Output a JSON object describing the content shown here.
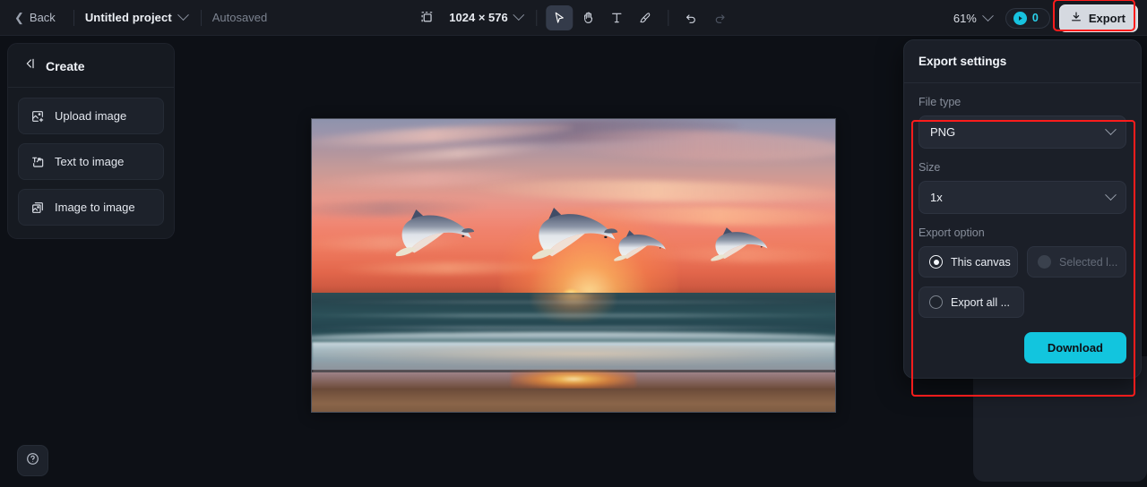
{
  "topbar": {
    "back_label": "Back",
    "project_name": "Untitled project",
    "autosave_label": "Autosaved",
    "canvas_size": "1024 × 576",
    "tools": [
      {
        "name": "select-tool",
        "glyph": "cursor",
        "active": true
      },
      {
        "name": "hand-tool",
        "glyph": "hand",
        "active": false
      },
      {
        "name": "text-tool",
        "glyph": "text",
        "active": false
      },
      {
        "name": "brush-tool",
        "glyph": "brush",
        "active": false
      },
      {
        "name": "undo-button",
        "glyph": "undo",
        "active": false
      },
      {
        "name": "redo-button",
        "glyph": "redo",
        "active": false
      }
    ],
    "zoom_level": "61%",
    "credits_count": "0",
    "export_label": "Export"
  },
  "create_panel": {
    "title": "Create",
    "collapse_icon": "collapse-left-icon",
    "items": [
      {
        "label": "Upload image",
        "icon": "upload-image-icon"
      },
      {
        "label": "Text to image",
        "icon": "text-to-image-icon"
      },
      {
        "label": "Image to image",
        "icon": "image-to-image-icon"
      }
    ]
  },
  "help": {
    "icon": "help-circle-icon"
  },
  "export_settings": {
    "title": "Export settings",
    "file_type": {
      "label": "File type",
      "value": "PNG"
    },
    "size": {
      "label": "Size",
      "value": "1x"
    },
    "export_option": {
      "label": "Export option",
      "options": [
        {
          "label": "This canvas",
          "selected": true,
          "disabled": false
        },
        {
          "label": "Selected l...",
          "selected": false,
          "disabled": true
        },
        {
          "label": "Export all ...",
          "selected": false,
          "disabled": false
        }
      ]
    },
    "download_label": "Download",
    "accent_color": "#12c5de",
    "highlight_color": "#ff1c1c"
  },
  "canvas": {
    "artboard_label": "dolphins-sunset-beach",
    "description": "Four bottlenose dolphins leaping above the ocean at sunset, with a pink and orange sky, breaking surf and a wet sand beach reflecting the sun."
  }
}
